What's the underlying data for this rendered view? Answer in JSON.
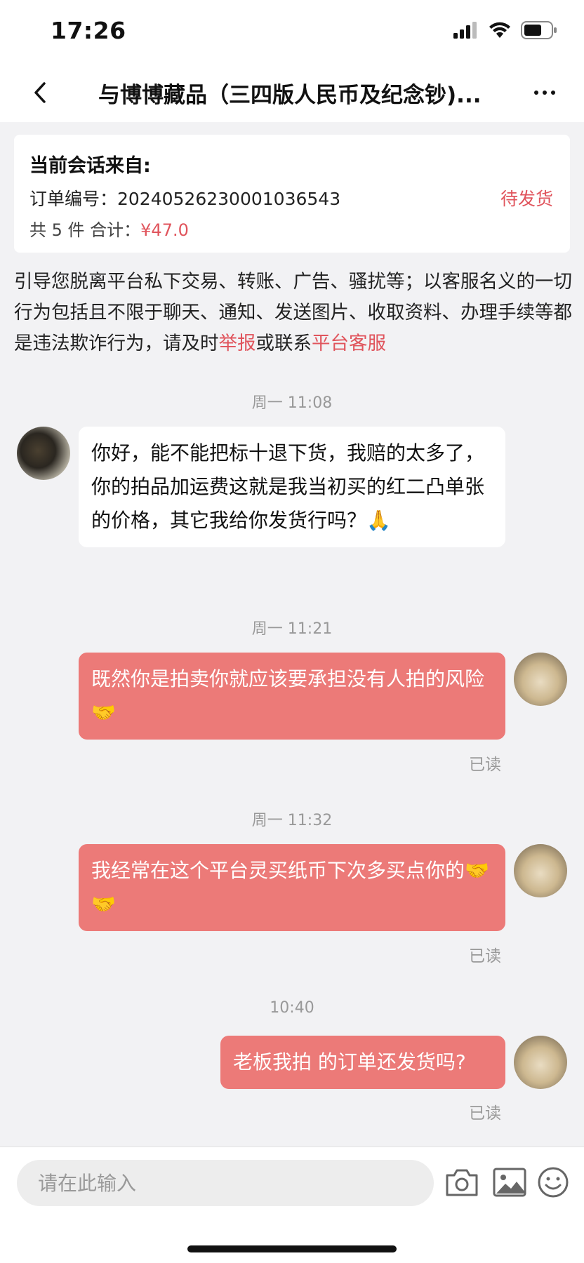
{
  "status_bar": {
    "time": "17:26"
  },
  "header": {
    "title": "与博博藏品（三四版人民币及纪念钞)..."
  },
  "order_card": {
    "heading": "当前会话来自:",
    "order_number": "订单编号：20240526230001036543",
    "status": "待发货",
    "items_total": "共 5 件 合计：",
    "price": "¥47.0"
  },
  "warning": {
    "text": "引导您脱离平台私下交易、转账、广告、骚扰等；以客服名义的一切行为包括且不限于聊天、通知、发送图片、收取资料、办理手续等都是违法欺诈行为，请及时",
    "report_link": "举报",
    "middle": "或联系",
    "service_link": "平台客服"
  },
  "messages": [
    {
      "time": "周一 11:08",
      "direction": "incoming",
      "text": "你好，能不能把标十退下货，我赔的太多了，你的拍品加运费这就是我当初买的红二凸单张的价格，其它我给你发货行吗？🙏"
    },
    {
      "time": "周一 11:21",
      "direction": "outgoing",
      "text": "既然你是拍卖你就应该要承担没有人拍的风险🤝",
      "status": "已读"
    },
    {
      "time": "周一 11:32",
      "direction": "outgoing",
      "text": "我经常在这个平台灵买纸币下次多买点你的🤝 🤝",
      "status": "已读"
    },
    {
      "time": "10:40",
      "direction": "outgoing",
      "text": "老板我拍 的订单还发货吗?",
      "status": "已读"
    }
  ],
  "input": {
    "placeholder": "请在此输入"
  },
  "icons": [
    "back-icon",
    "more-icon",
    "camera-icon",
    "image-icon",
    "emoji-icon"
  ],
  "colors": {
    "accent": "#e0545c",
    "bubble_out": "#ec7a78"
  }
}
